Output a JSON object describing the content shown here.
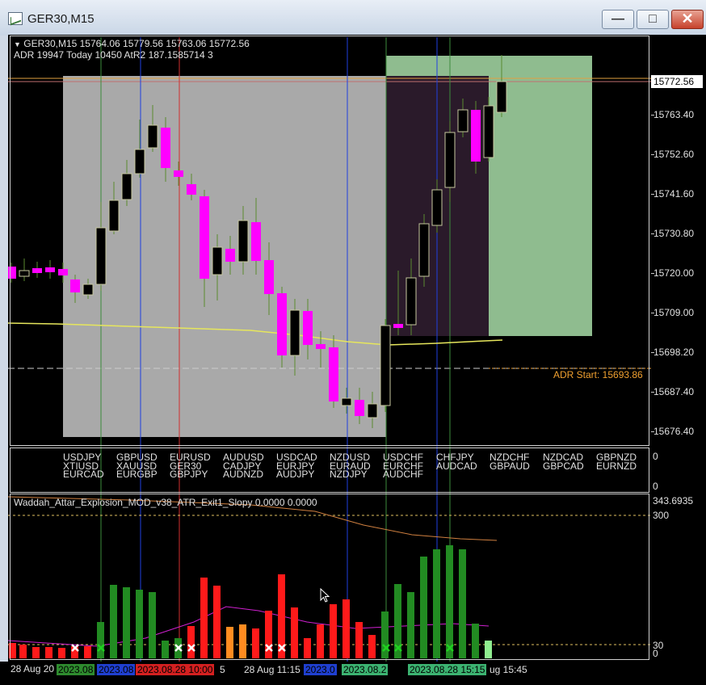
{
  "window": {
    "title": "GER30,M15"
  },
  "header": {
    "line1": "GER30,M15  15764.06 15779.56 15763.06 15772.56",
    "line2": "ADR 19947  Today 10450 AtR2 187.1585714 3"
  },
  "price_axis": {
    "current": "15772.56",
    "ticks": [
      "15763.40",
      "15752.60",
      "15741.60",
      "15730.80",
      "15720.00",
      "15709.00",
      "15698.20",
      "15687.40",
      "15676.40"
    ]
  },
  "adr_label": "ADR Start: 15693.86",
  "symbol_columns": [
    "USDJPY\nXTIUSD\nEURCAD",
    "GBPUSD\nXAUUSD\nEURGBP",
    "EURUSD\nGER30\nGBPJPY",
    "AUDUSD\nCADJPY\nAUDNZD",
    "USDCAD\nEURJPY\nAUDJPY",
    "NZDUSD\nEURAUD\nNZDJPY",
    "USDCHF\nEURCHF\nAUDCHF",
    "CHFJPY\nAUDCAD",
    "NZDCHF\nGBPAUD",
    "NZDCAD\nGBPCAD",
    "GBPNZD\nEURNZD"
  ],
  "symbol_axis": {
    "top": "0",
    "bottom": "0"
  },
  "indicator": {
    "title": "Waddah_Attar_Explosion_MOD_v38_ATR_Exit1_Slopy 0.0000 0.0000",
    "axis_max": "343.6935",
    "level_300": "300",
    "level_30": "30",
    "level_0": "0"
  },
  "time_axis": {
    "left_label": "28 Aug 20",
    "badges": [
      {
        "text": "2023.08",
        "color": "#2e8b2e"
      },
      {
        "text": "2023.08",
        "color": "#1f3fd0"
      },
      {
        "text": "2023.08.28 10:00",
        "color": "#d42020"
      },
      {
        "text": "5",
        "color": "#000000"
      },
      {
        "text": "28 Aug 11:15",
        "color": "#000000"
      },
      {
        "text": "2023.0",
        "color": "#1f3fd0"
      },
      {
        "text": "2023.08.2",
        "color": "#3cb371"
      },
      {
        "text": "2023.08.28 15:15",
        "color": "#3cb371"
      },
      {
        "text": "ug 15:45",
        "color": "#000000"
      }
    ]
  },
  "colors": {
    "bull_candle": "#000000",
    "bear_candle": "#ff00ff",
    "session_grey": "#a9a9a9",
    "session_dark": "#2a1a2a",
    "session_green": "#8fbc8f",
    "ma_line": "#e6e65c",
    "bar_green": "#228b22",
    "bar_red": "#ff1a1a"
  }
}
